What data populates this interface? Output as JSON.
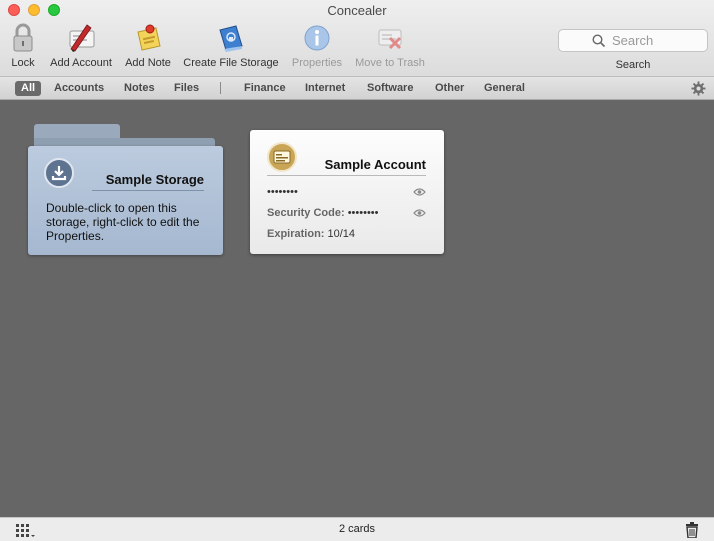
{
  "window": {
    "title": "Concealer"
  },
  "toolbar": {
    "items": [
      {
        "label": "Lock",
        "icon": "lock-icon",
        "enabled": true
      },
      {
        "label": "Add Account",
        "icon": "add-account-icon",
        "enabled": true
      },
      {
        "label": "Add Note",
        "icon": "add-note-icon",
        "enabled": true
      },
      {
        "label": "Create File Storage",
        "icon": "file-storage-icon",
        "enabled": true
      },
      {
        "label": "Properties",
        "icon": "info-icon",
        "enabled": false
      },
      {
        "label": "Move to Trash",
        "icon": "move-to-trash-icon",
        "enabled": false
      }
    ],
    "search": {
      "placeholder": "Search",
      "label": "Search"
    }
  },
  "filters": {
    "primary": [
      "All",
      "Accounts",
      "Notes",
      "Files"
    ],
    "secondary": [
      "Finance",
      "Internet",
      "Software",
      "Other",
      "General"
    ],
    "selected": "All"
  },
  "cards": {
    "storage": {
      "title": "Sample Storage",
      "description": "Double-click to open this storage, right-click to edit the Properties.",
      "icon": "download-icon",
      "color": "#a5b8d0"
    },
    "account": {
      "title": "Sample Account",
      "icon": "card-icon",
      "password": "••••••••",
      "security_code_label": "Security Code:",
      "security_code": "••••••••",
      "expiration_label": "Expiration:",
      "expiration": "10/14"
    }
  },
  "status": {
    "count_text": "2 cards"
  }
}
